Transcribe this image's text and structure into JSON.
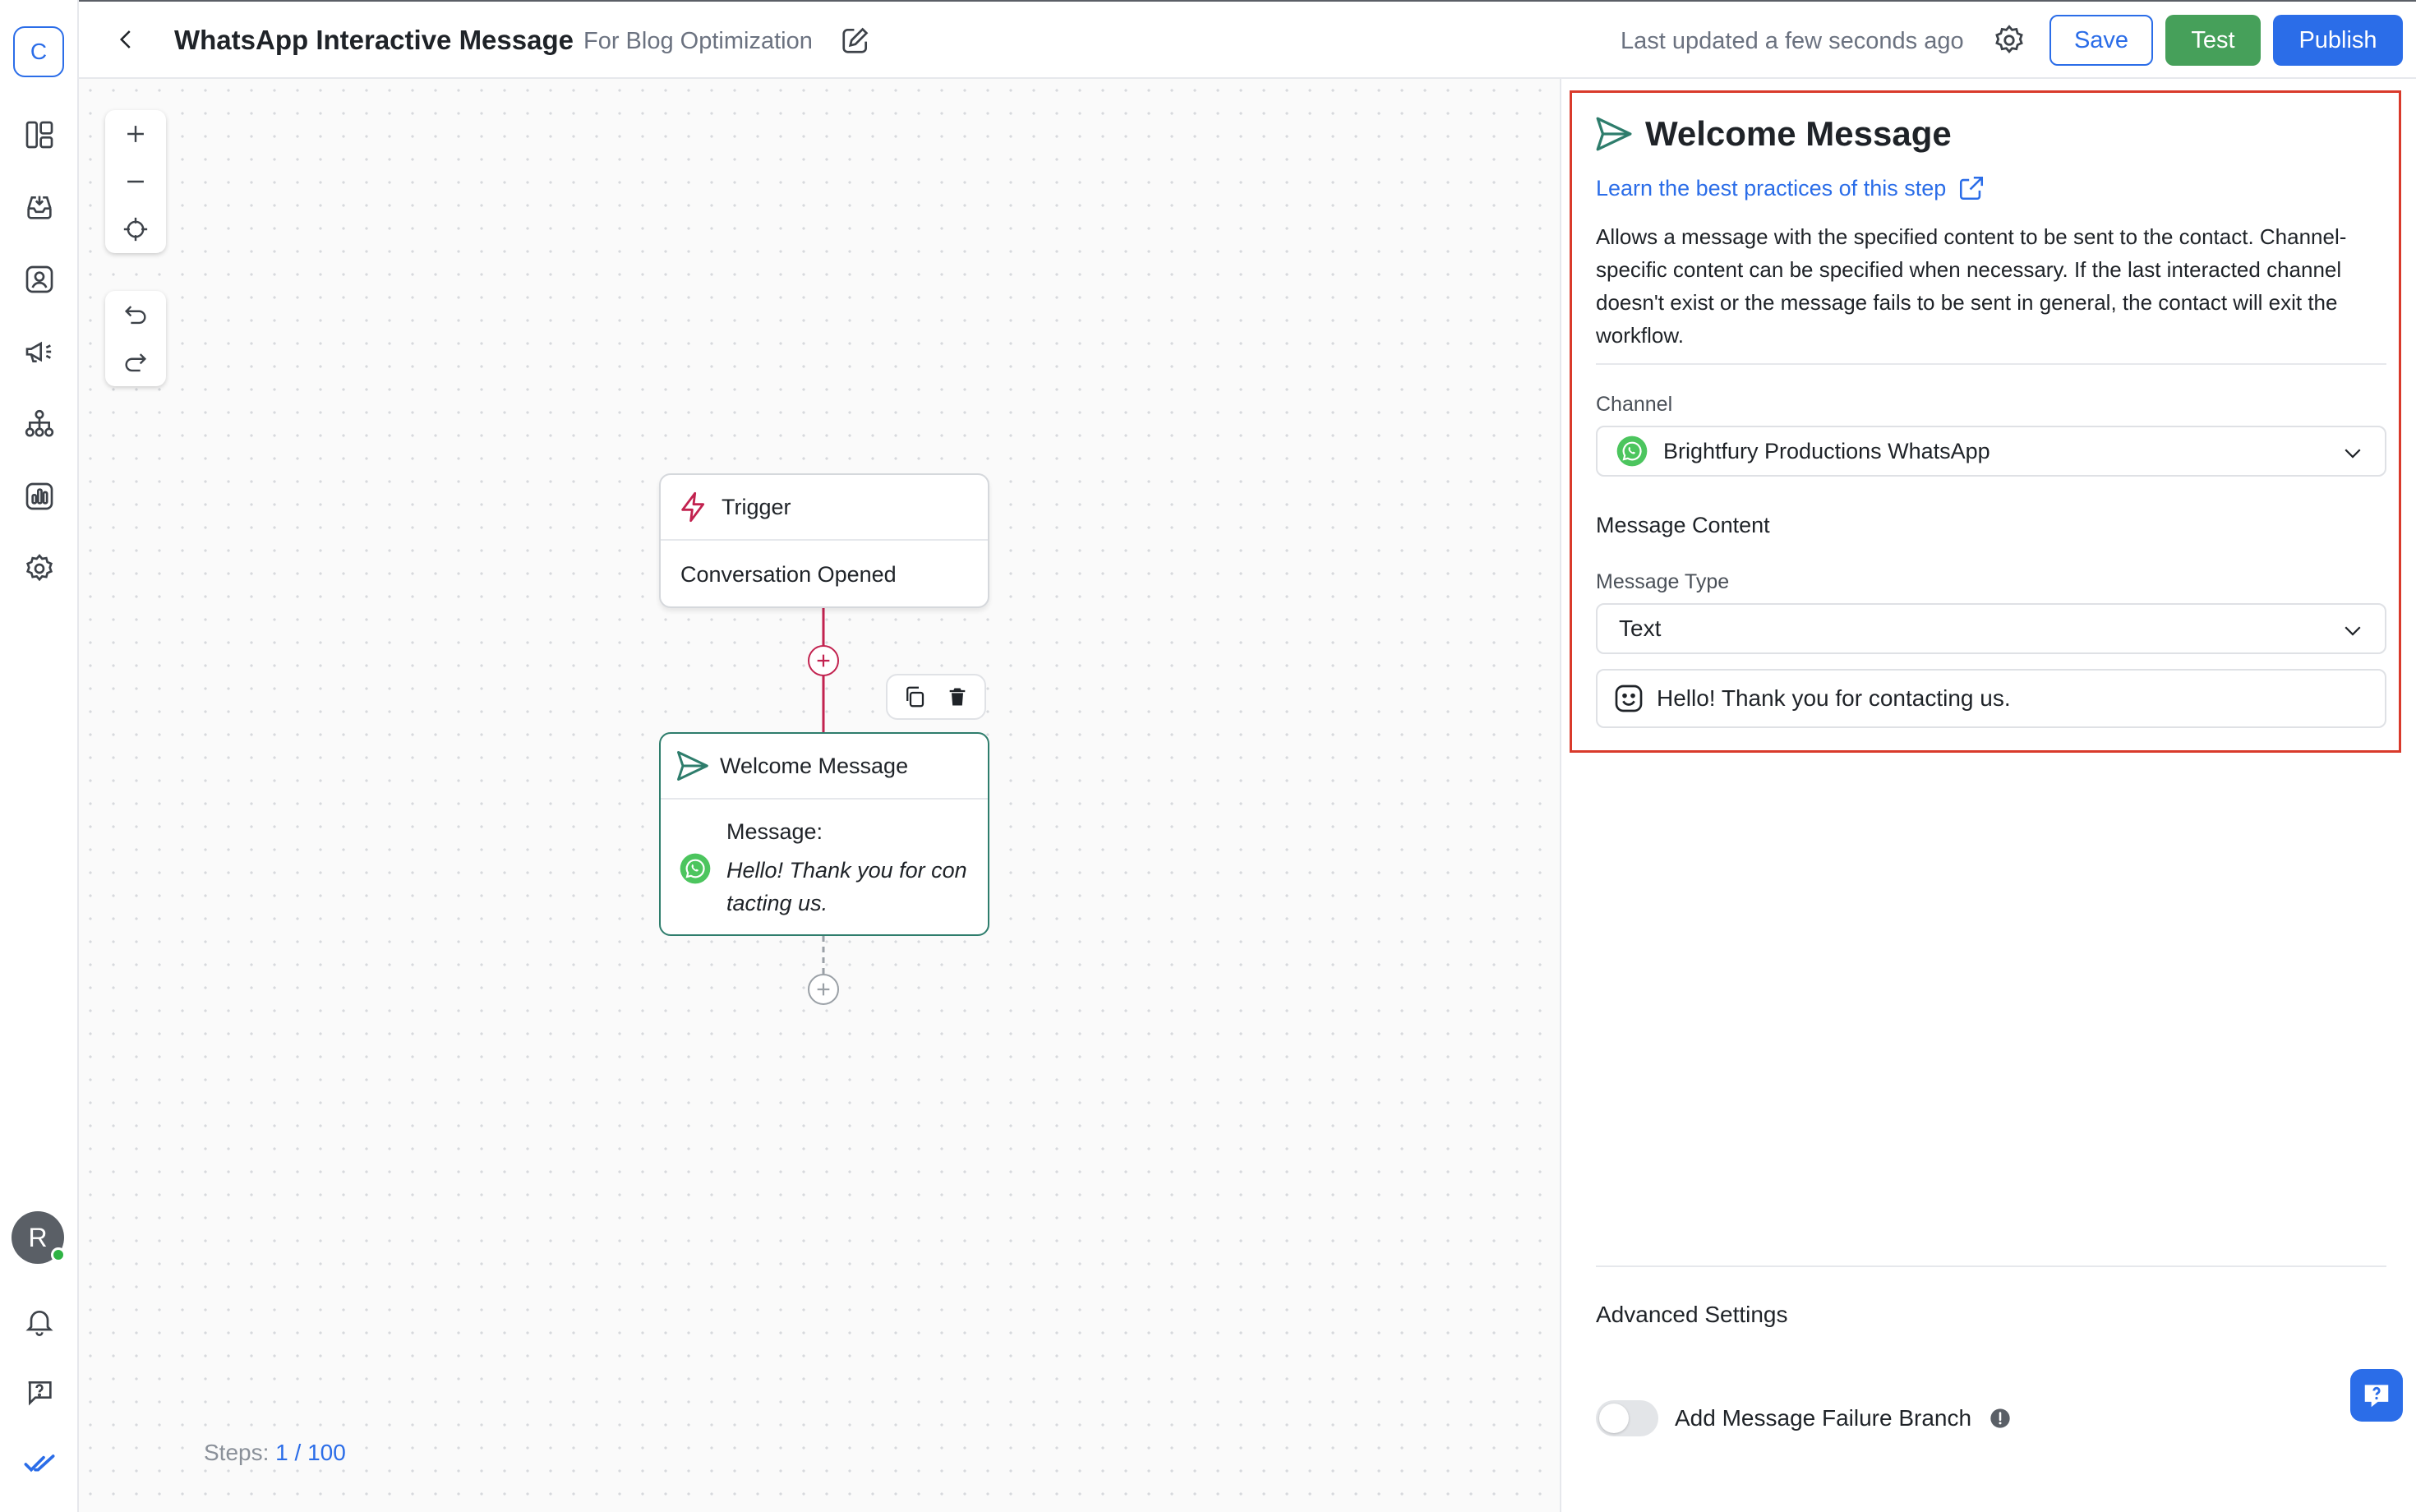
{
  "sidebar": {
    "workspace_initial": "C",
    "items": [
      {
        "name": "dashboard-icon"
      },
      {
        "name": "inbox-icon"
      },
      {
        "name": "contacts-icon"
      },
      {
        "name": "broadcast-icon"
      },
      {
        "name": "workflows-icon"
      },
      {
        "name": "reports-icon"
      },
      {
        "name": "settings-icon"
      }
    ],
    "user_initial": "R"
  },
  "header": {
    "title": "WhatsApp Interactive Message",
    "subtitle": "For Blog Optimization",
    "last_updated": "Last updated a few seconds ago",
    "save_label": "Save",
    "test_label": "Test",
    "publish_label": "Publish"
  },
  "canvas": {
    "trigger": {
      "title": "Trigger",
      "event": "Conversation Opened"
    },
    "message_node": {
      "title": "Welcome Message",
      "label": "Message:",
      "body": "Hello! Thank you for contacting us."
    },
    "steps": {
      "label": "Steps:",
      "used": "1",
      "separator": " / ",
      "max": "100"
    }
  },
  "panel": {
    "title": "Welcome Message",
    "learn_link": "Learn the best practices of this step",
    "description": "Allows a message with the specified content to be sent to the contact. Channel-specific content can be specified when necessary. If the last interacted channel doesn't exist or the message fails to be sent in general, the contact will exit the workflow.",
    "channel_label": "Channel",
    "channel_value": "Brightfury Productions WhatsApp",
    "message_content_label": "Message Content",
    "message_type_label": "Message Type",
    "message_type_value": "Text",
    "message_text": "Hello! Thank you for contacting us.",
    "advanced_title": "Advanced Settings",
    "failure_branch_label": "Add Message Failure Branch",
    "failure_branch_enabled": false
  },
  "colors": {
    "primary": "#2b6de8",
    "success": "#46a05a",
    "trigger_accent": "#c2224f",
    "message_accent": "#2e7d6c",
    "highlight": "#d93a2b",
    "whatsapp": "#4cc55e"
  }
}
